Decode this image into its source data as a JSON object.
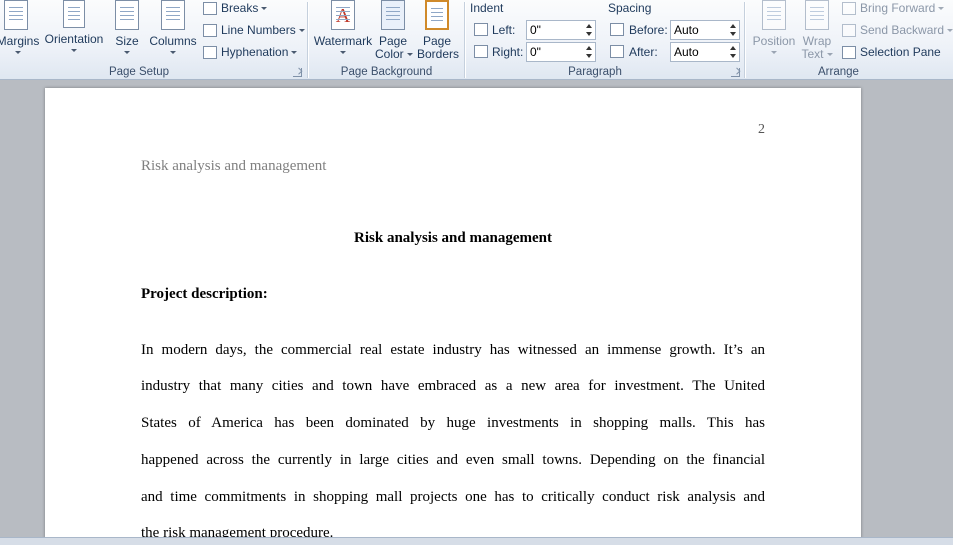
{
  "ribbon": {
    "page_setup": {
      "label": "Page Setup",
      "margins": "Margins",
      "orientation": "Orientation",
      "size": "Size",
      "columns": "Columns",
      "breaks": "Breaks",
      "line_numbers": "Line Numbers",
      "hyphenation": "Hyphenation"
    },
    "page_background": {
      "label": "Page Background",
      "watermark": "Watermark",
      "page_color_1": "Page",
      "page_color_2": "Color",
      "page_borders_1": "Page",
      "page_borders_2": "Borders"
    },
    "paragraph": {
      "label": "Paragraph",
      "indent": "Indent",
      "left_label": "Left:",
      "left_value": "0\"",
      "right_label": "Right:",
      "right_value": "0\"",
      "spacing": "Spacing",
      "before_label": "Before:",
      "before_value": "Auto",
      "after_label": "After:",
      "after_value": "Auto"
    },
    "arrange": {
      "label": "Arrange",
      "position": "Position",
      "wrap_1": "Wrap",
      "wrap_2": "Text",
      "bring_forward": "Bring Forward",
      "send_backward": "Send Backward",
      "selection_pane": "Selection Pane"
    }
  },
  "document": {
    "page_number": "2",
    "running_head": "Risk analysis  and management",
    "title": "Risk analysis and management",
    "subheading": "Project description:",
    "body_lines": [
      "In modern days, the commercial real estate industry has witnessed an immense growth. It’s an",
      "industry that many cities and town have embraced as a new area for investment. The United",
      "States of America has been dominated by huge investments in shopping malls. This has",
      "happened across the currently in large cities and even small towns. Depending on the financial",
      "and time commitments in shopping mall projects one has to critically conduct risk analysis and",
      "the risk management procedure."
    ]
  },
  "colors": {
    "ribbon_text": "#1e395b",
    "workspace": "#b8bcc2",
    "running_head": "#808080"
  }
}
